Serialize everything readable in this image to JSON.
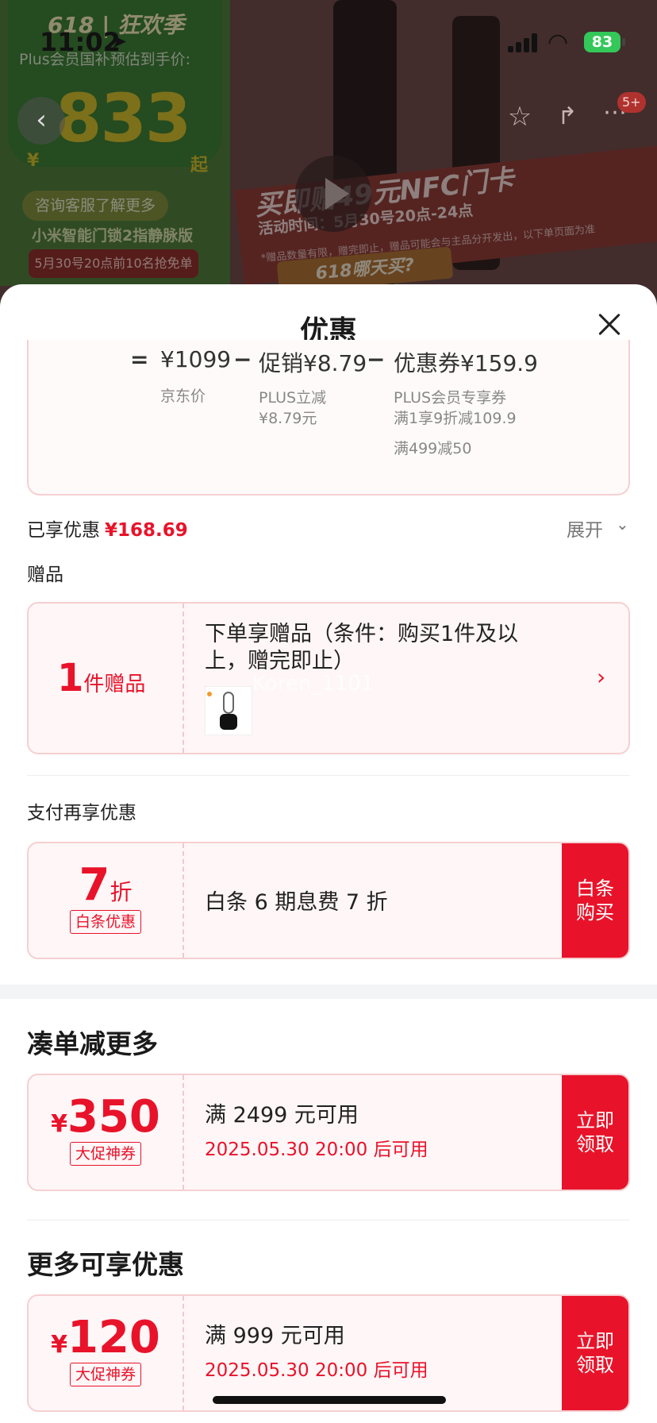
{
  "status_bar": {
    "time": "11:02",
    "battery": "83"
  },
  "background": {
    "tag": "618 | 狂欢季",
    "price_caption": "Plus会员国补预估到手价:",
    "price": "833",
    "currency": "¥",
    "qi": "起",
    "pill1": "咨询客服了解更多",
    "line2": "小米智能门锁2指静脉版",
    "pill2": "5月30号20点前10名抢免单",
    "banner_title": "买即赠49元NFC门卡",
    "banner_sub": "活动时间：5月30号20点-24点",
    "banner_note": "*赠品数量有限，赠完即止，赠品可能会与主品分开发出，以下单页面为准",
    "banner_618": "618哪天买?",
    "more_badge": "5+"
  },
  "sheet": {
    "title": "优惠",
    "calc": {
      "equals": "=",
      "base": "¥1099",
      "minus": "−",
      "promo": "促销¥8.79",
      "coupon": "优惠券¥159.9",
      "base_label": "京东价",
      "promo_label_1": "PLUS立减",
      "promo_label_2": "¥8.79元",
      "coupon_label_1": "PLUS会员专享券",
      "coupon_label_2": "满1享9折减109.9",
      "coupon_label_3": "满499减50"
    },
    "enjoyed_label": "已享优惠",
    "enjoyed_amount": "¥168.69",
    "expand_label": "展开",
    "gift": {
      "heading": "赠品",
      "count": "1",
      "count_label": "件赠品",
      "text": "下单享赠品（条件：购买1件及以上，赠完即止）",
      "watermark": "Koren_1101"
    },
    "pay": {
      "heading": "支付再享优惠",
      "discount": "7",
      "discount_unit": "折",
      "tag": "白条优惠",
      "desc": "白条 6 期息费 7 折",
      "button": "白条购买"
    },
    "section1": {
      "heading": "凑单减更多",
      "currency": "¥",
      "amount": "350",
      "tag": "大促神券",
      "title": "满 2499 元可用",
      "time": "2025.05.30 20:00 后可用",
      "button": "立即领取"
    },
    "section2": {
      "heading": "更多可享优惠",
      "currency": "¥",
      "amount": "120",
      "tag": "大促神券",
      "title": "满 999 元可用",
      "time": "2025.05.30 20:00 后可用",
      "button": "立即领取"
    }
  },
  "colors": {
    "accent": "#e8132a",
    "card_border": "#f6cfd2",
    "card_bg": "#fff6f7"
  }
}
